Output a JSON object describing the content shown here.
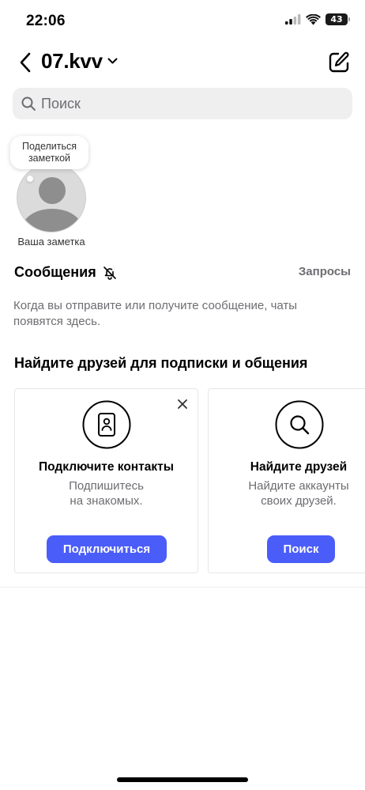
{
  "status": {
    "time": "22:06",
    "battery": "43"
  },
  "header": {
    "username": "07.kvv",
    "back_icon": "chevron-left-icon",
    "edit_icon": "compose-icon"
  },
  "search": {
    "placeholder": "Поиск"
  },
  "notes": {
    "bubble_text": "Поделиться заметкой",
    "label": "Ваша заметка"
  },
  "messages": {
    "title": "Сообщения",
    "requests": "Запросы",
    "empty_text": "Когда вы отправите или получите сообщение, чаты появятся здесь."
  },
  "find_friends": {
    "title": "Найдите друзей для подписки и общения",
    "cards": [
      {
        "title": "Подключите контакты",
        "subtitle_line1": "Подпишитесь",
        "subtitle_line2": "на знакомых.",
        "button": "Подключиться"
      },
      {
        "title": "Найдите друзей",
        "subtitle_line1": "Найдите аккаунты",
        "subtitle_line2": "своих друзей.",
        "button": "Поиск"
      }
    ]
  },
  "colors": {
    "accent": "#4a5df9",
    "secondary_text": "#6d6d72",
    "search_bg": "#efeff0"
  }
}
